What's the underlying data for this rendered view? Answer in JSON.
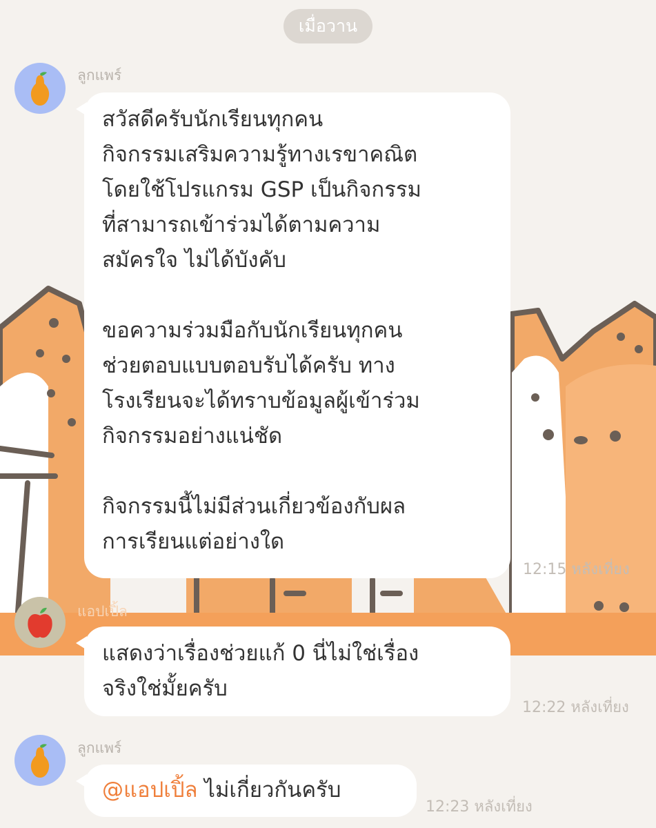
{
  "chat": {
    "date_separator": "เมื่อวาน",
    "messages": [
      {
        "sender": "ลูกแพร์",
        "avatar_icon": "pear-icon",
        "lines": [
          "สวัสดีครับนักเรียนทุกคน",
          "กิจกรรมเสริมความรู้ทางเรขาคณิต",
          "โดยใช้โปรแกรม GSP เป็นกิจกรรม",
          "ที่สามารถเข้าร่วมได้ตามความ",
          "สมัครใจ ไม่ได้บังคับ",
          "",
          "ขอความร่วมมือกับนักเรียนทุกคน",
          "ช่วยตอบแบบตอบรับได้ครับ ทาง",
          "โรงเรียนจะได้ทราบข้อมูลผู้เข้าร่วม",
          "กิจกรรมอย่างแน่ชัด",
          "",
          "กิจกรรมนี้ไม่มีส่วนเกี่ยวข้องกับผล",
          "การเรียนแต่อย่างใด"
        ],
        "time": "12:15 หลังเที่ยง"
      },
      {
        "sender": "แอปเปิ้ล",
        "avatar_icon": "apple-icon",
        "lines": [
          "แสดงว่าเรื่องช่วยแก้ 0 นี่ไม่ใช่เรื่อง",
          "จริงใช่มั้ยครับ"
        ],
        "time": "12:22 หลังเที่ยง"
      },
      {
        "sender": "ลูกแพร์",
        "avatar_icon": "pear-icon",
        "mention": "@แอปเปิ้ล",
        "text": " ไม่เกี่ยวกันครับ",
        "time": "12:23 หลังเที่ยง"
      }
    ]
  },
  "colors": {
    "background": "#f5f2ee",
    "wallpaper_cat_orange": "#f2a968",
    "wallpaper_band": "#f4a05a",
    "bubble": "#ffffff",
    "mention": "#ef7f3b",
    "pear_avatar_bg": "#a9bdf5",
    "apple_avatar_bg": "#c9c2a8"
  }
}
